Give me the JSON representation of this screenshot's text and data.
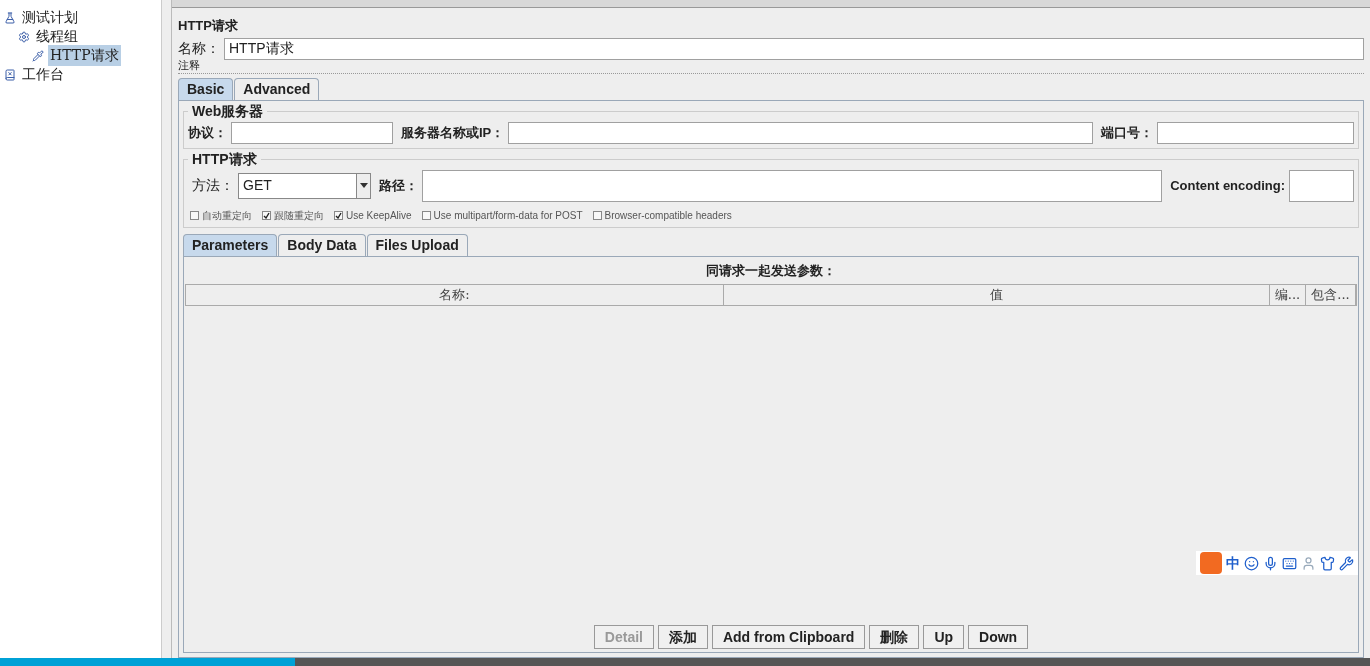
{
  "tree": [
    {
      "label": "测试计划",
      "kind": "plan",
      "selected": false,
      "children": [
        {
          "label": "线程组",
          "kind": "group",
          "selected": false,
          "children": [
            {
              "label": "HTTP请求",
              "kind": "sampler",
              "selected": true
            }
          ]
        }
      ]
    },
    {
      "label": "工作台",
      "kind": "workbench",
      "selected": false
    }
  ],
  "panel": {
    "title": "HTTP请求",
    "name_label": "名称：",
    "name_value": "HTTP请求",
    "comment_label": "注释"
  },
  "tabs": [
    {
      "label": "Basic",
      "selected": true
    },
    {
      "label": "Advanced",
      "selected": false
    }
  ],
  "web_server": {
    "legend": "Web服务器",
    "protocol_label": "协议：",
    "server_label": "服务器名称或IP：",
    "port_label": "端口号："
  },
  "http_request": {
    "legend": "HTTP请求",
    "method_label": "方法：",
    "method_value": "GET",
    "path_label": "路径：",
    "encoding_label": "Content encoding:"
  },
  "options": [
    {
      "label": "自动重定向",
      "checked": false
    },
    {
      "label": "跟随重定向",
      "checked": true
    },
    {
      "label": "Use KeepAlive",
      "checked": true
    },
    {
      "label": "Use multipart/form-data for POST",
      "checked": false
    },
    {
      "label": "Browser-compatible headers",
      "checked": false
    }
  ],
  "sub_tabs": [
    {
      "label": "Parameters",
      "selected": true
    },
    {
      "label": "Body Data",
      "selected": false
    },
    {
      "label": "Files Upload",
      "selected": false
    }
  ],
  "params": {
    "caption": "同请求一起发送参数：",
    "columns": [
      "名称:",
      "值",
      "编...",
      "包含..."
    ]
  },
  "buttons": [
    {
      "label": "Detail",
      "disabled": true
    },
    {
      "label": "添加",
      "disabled": false
    },
    {
      "label": "Add from Clipboard",
      "disabled": false
    },
    {
      "label": "删除",
      "disabled": false
    },
    {
      "label": "Up",
      "disabled": false
    },
    {
      "label": "Down",
      "disabled": false
    }
  ],
  "ime": {
    "label": "中"
  },
  "progress": {
    "level": 0.215
  }
}
